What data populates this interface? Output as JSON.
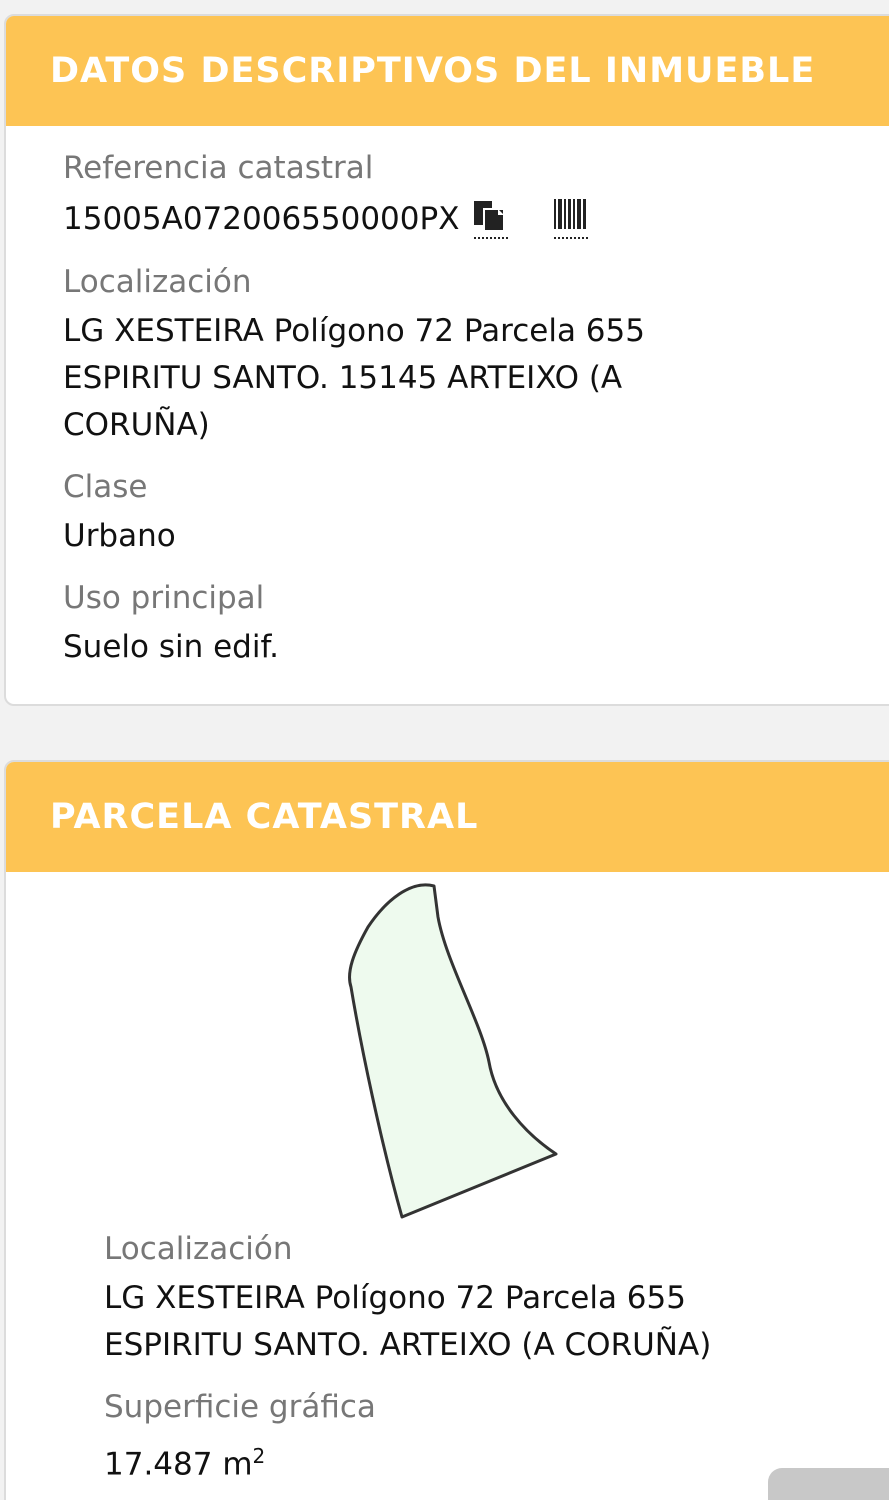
{
  "descriptive": {
    "title": "DATOS DESCRIPTIVOS DEL INMUEBLE",
    "ref_label": "Referencia catastral",
    "ref_value": "15005A07200655 0000PX",
    "ref_value_clean": "15005A072006550000PX",
    "location_label": "Localización",
    "location_line1": "LG XESTEIRA Polígono 72 Parcela 655",
    "location_line2": "ESPIRITU SANTO. 15145 ARTEIXO (A",
    "location_line3": "CORUÑA)",
    "class_label": "Clase",
    "class_value": "Urbano",
    "use_label": "Uso principal",
    "use_value": "Suelo sin edif."
  },
  "parcel": {
    "title": "PARCELA CATASTRAL",
    "location_label": "Localización",
    "location_line1": "LG XESTEIRA Polígono 72 Parcela 655",
    "location_line2": "ESPIRITU SANTO. ARTEIXO (A CORUÑA)",
    "area_label": "Superficie gráfica",
    "area_value": "17.487 m",
    "area_unit_exp": "2"
  },
  "icons": {
    "copy": "copy-icon",
    "barcode": "barcode-icon"
  },
  "colors": {
    "header_bg": "#fdc454",
    "header_text": "#ffffff",
    "parcel_fill": "#eefaee",
    "parcel_stroke": "#333333"
  }
}
